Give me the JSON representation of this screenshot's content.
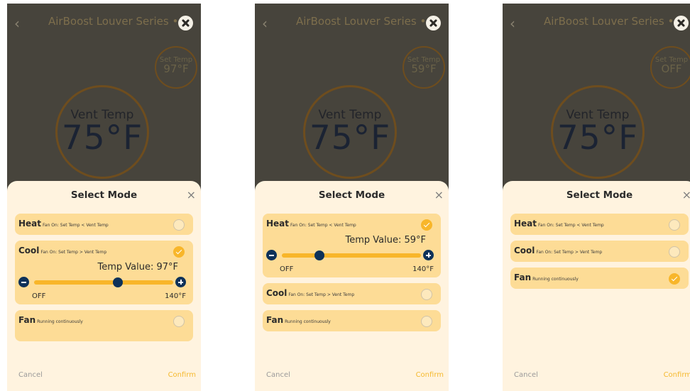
{
  "screens": [
    {
      "header": {
        "back_icon": "chevron-left-icon",
        "title": "AirBoost Louver Series",
        "more_label": "•••",
        "close_icon": "close-circle-icon"
      },
      "set_temp": {
        "label": "Set Temp",
        "value": "97°F"
      },
      "vent_temp": {
        "label": "Vent Temp",
        "value": "75°F"
      },
      "sheet": {
        "title": "Select Mode",
        "close_label": "×",
        "modes": [
          {
            "name": "Heat",
            "desc": "Fan On: Set Temp < Vent Temp",
            "selected": false
          },
          {
            "name": "Cool",
            "desc": "Fan On: Set Temp > Vent Temp",
            "selected": true
          },
          {
            "name": "Fan",
            "desc": "Running continuously",
            "selected": false
          }
        ],
        "slider": {
          "value_label": "Temp Value: 97°F",
          "min_label": "OFF",
          "max_label": "140°F",
          "position": 0.6
        },
        "cancel_label": "Cancel",
        "confirm_label": "Confirm"
      }
    },
    {
      "header": {
        "back_icon": "chevron-left-icon",
        "title": "AirBoost Louver Series",
        "more_label": "•••",
        "close_icon": "close-circle-icon"
      },
      "set_temp": {
        "label": "Set Temp",
        "value": "59°F"
      },
      "vent_temp": {
        "label": "Vent Temp",
        "value": "75°F"
      },
      "sheet": {
        "title": "Select Mode",
        "close_label": "×",
        "modes": [
          {
            "name": "Heat",
            "desc": "Fan On: Set Temp < Vent Temp",
            "selected": true
          },
          {
            "name": "Cool",
            "desc": "Fan On: Set Temp > Vent Temp",
            "selected": false
          },
          {
            "name": "Fan",
            "desc": "Running continuously",
            "selected": false
          }
        ],
        "slider": {
          "value_label": "Temp Value: 59°F",
          "min_label": "OFF",
          "max_label": "140°F",
          "position": 0.27
        },
        "cancel_label": "Cancel",
        "confirm_label": "Confirm"
      }
    },
    {
      "header": {
        "back_icon": "chevron-left-icon",
        "title": "AirBoost Louver Series",
        "more_label": "•••",
        "close_icon": "close-circle-icon"
      },
      "set_temp": {
        "label": "Set Temp",
        "value": "OFF"
      },
      "vent_temp": {
        "label": "Vent Temp",
        "value": "75°F"
      },
      "sheet": {
        "title": "Select Mode",
        "close_label": "×",
        "modes": [
          {
            "name": "Heat",
            "desc": "Fan On: Set Temp < Vent Temp",
            "selected": false
          },
          {
            "name": "Cool",
            "desc": "Fan On: Set Temp > Vent Temp",
            "selected": false
          },
          {
            "name": "Fan",
            "desc": "Running continuously",
            "selected": true
          }
        ],
        "cancel_label": "Cancel",
        "confirm_label": "Confirm"
      }
    }
  ]
}
